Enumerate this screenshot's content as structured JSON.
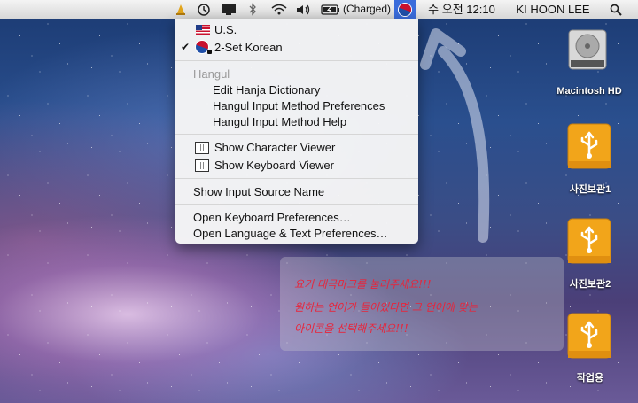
{
  "menubar": {
    "battery_label": "(Charged)",
    "clock": "수 오전 12:10",
    "user": "KI HOON LEE"
  },
  "input_menu": {
    "sources": [
      {
        "label": "U.S.",
        "checked": false,
        "icon": "us-flag-icon"
      },
      {
        "label": "2-Set Korean",
        "checked": true,
        "icon": "korean-input-icon"
      }
    ],
    "section_header": "Hangul",
    "hangul_items": [
      "Edit Hanja Dictionary",
      "Hangul Input Method Preferences",
      "Hangul Input Method Help"
    ],
    "viewer_items": [
      {
        "label": "Show Character Viewer",
        "icon": "character-viewer-icon"
      },
      {
        "label": "Show Keyboard Viewer",
        "icon": "keyboard-viewer-icon"
      }
    ],
    "show_name_item": "Show Input Source Name",
    "pref_items": [
      "Open Keyboard Preferences…",
      "Open Language & Text Preferences…"
    ]
  },
  "desktop_icons": [
    {
      "label": "Macintosh HD",
      "icon": "hard-drive-icon"
    },
    {
      "label": "사진보관1",
      "icon": "usb-drive-icon"
    },
    {
      "label": "사진보관2",
      "icon": "usb-drive-icon"
    },
    {
      "label": "작업용",
      "icon": "usb-drive-icon"
    }
  ],
  "annotation": {
    "lines": [
      "요기 태극마크를 눌러주세요!!!",
      "원하는 언어가 들어있다면 그 언어에 맞는",
      "아이콘을 선택해주세요!!!"
    ],
    "color": "#e8243a"
  }
}
